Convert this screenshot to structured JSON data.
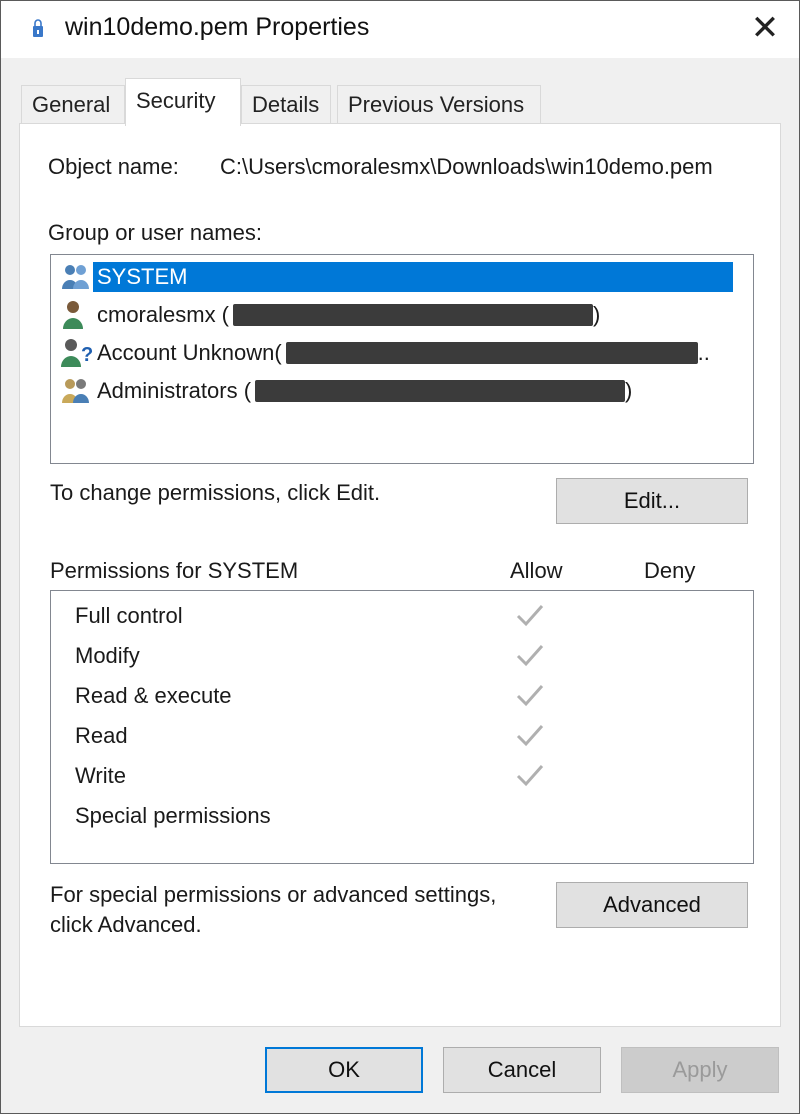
{
  "window": {
    "title": "win10demo.pem Properties",
    "close_symbol": "✕"
  },
  "tabs": [
    {
      "label": "General",
      "active": false
    },
    {
      "label": "Security",
      "active": true
    },
    {
      "label": "Details",
      "active": false
    },
    {
      "label": "Previous Versions",
      "active": false
    }
  ],
  "security": {
    "object_name_label": "Object name:",
    "object_name_value": "C:\\Users\\cmoralesmx\\Downloads\\win10demo.pem",
    "group_label": "Group or user names:",
    "principals": [
      {
        "name": "SYSTEM",
        "suffix": "",
        "icon": "group-users-icon",
        "selected": true
      },
      {
        "name": "cmoralesmx (",
        "suffix": ")",
        "icon": "user-icon",
        "selected": false
      },
      {
        "name": "Account Unknown(",
        "suffix": "..",
        "icon": "unknown-account-icon",
        "selected": false
      },
      {
        "name": "Administrators (",
        "suffix": ")",
        "icon": "admin-group-icon",
        "selected": false
      }
    ],
    "change_hint": "To change permissions, click Edit.",
    "edit_button": "Edit...",
    "permissions_header": "Permissions for SYSTEM",
    "allow_header": "Allow",
    "deny_header": "Deny",
    "permissions": [
      {
        "name": "Full control",
        "allow": true,
        "deny": false
      },
      {
        "name": "Modify",
        "allow": true,
        "deny": false
      },
      {
        "name": "Read & execute",
        "allow": true,
        "deny": false
      },
      {
        "name": "Read",
        "allow": true,
        "deny": false
      },
      {
        "name": "Write",
        "allow": true,
        "deny": false
      },
      {
        "name": "Special permissions",
        "allow": false,
        "deny": false
      }
    ],
    "advanced_hint_line1": "For special permissions or advanced settings,",
    "advanced_hint_line2": "click Advanced.",
    "advanced_button": "Advanced"
  },
  "footer": {
    "ok": "OK",
    "cancel": "Cancel",
    "apply": "Apply"
  },
  "colors": {
    "selection": "#0078d7",
    "check": "#b0b0b0",
    "redaction": "#3b3b3b"
  }
}
